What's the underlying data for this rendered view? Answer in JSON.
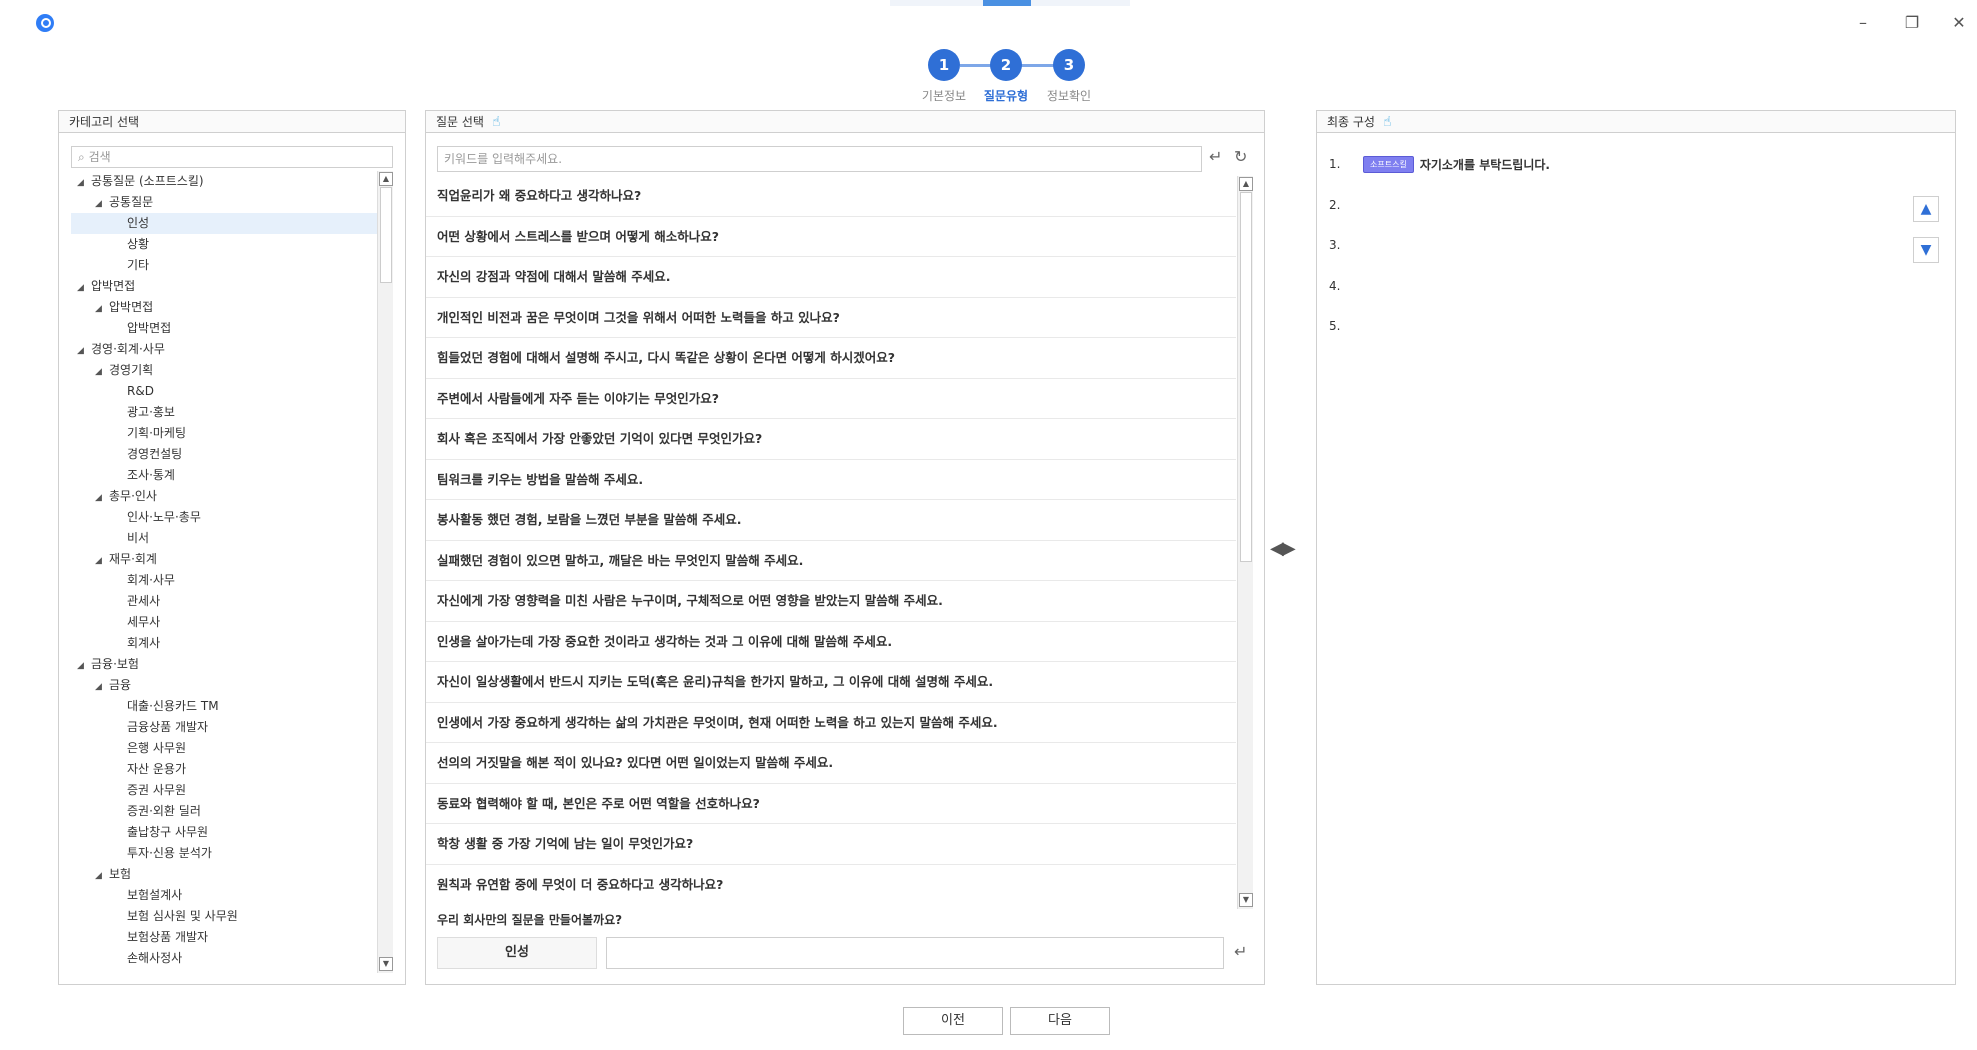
{
  "window": {
    "minimize": "–",
    "restore": "❐",
    "close": "✕"
  },
  "steps": [
    {
      "num": "1",
      "label": "기본정보"
    },
    {
      "num": "2",
      "label": "질문유형"
    },
    {
      "num": "3",
      "label": "정보확인"
    }
  ],
  "category_panel": {
    "title": "카테고리 선택",
    "search_placeholder": "검색",
    "tree": [
      {
        "label": "공통질문 (소프트스킬)",
        "level": 0,
        "expander": "◢"
      },
      {
        "label": "공통질문",
        "level": 1,
        "expander": "◢"
      },
      {
        "label": "인성",
        "level": 2,
        "expander": "",
        "selected": true
      },
      {
        "label": "상황",
        "level": 2,
        "expander": ""
      },
      {
        "label": "기타",
        "level": 2,
        "expander": ""
      },
      {
        "label": "압박면접",
        "level": 0,
        "expander": "◢"
      },
      {
        "label": "압박면접",
        "level": 1,
        "expander": "◢"
      },
      {
        "label": "압박면접",
        "level": 2,
        "expander": ""
      },
      {
        "label": "경영·회계·사무",
        "level": 0,
        "expander": "◢"
      },
      {
        "label": "경영기획",
        "level": 1,
        "expander": "◢"
      },
      {
        "label": "R&D",
        "level": 2,
        "expander": ""
      },
      {
        "label": "광고·홍보",
        "level": 2,
        "expander": ""
      },
      {
        "label": "기획·마케팅",
        "level": 2,
        "expander": ""
      },
      {
        "label": "경영컨설팅",
        "level": 2,
        "expander": ""
      },
      {
        "label": "조사·통계",
        "level": 2,
        "expander": ""
      },
      {
        "label": "총무·인사",
        "level": 1,
        "expander": "◢"
      },
      {
        "label": "인사·노무·총무",
        "level": 2,
        "expander": ""
      },
      {
        "label": "비서",
        "level": 2,
        "expander": ""
      },
      {
        "label": "재무·회계",
        "level": 1,
        "expander": "◢"
      },
      {
        "label": "회계·사무",
        "level": 2,
        "expander": ""
      },
      {
        "label": "관세사",
        "level": 2,
        "expander": ""
      },
      {
        "label": "세무사",
        "level": 2,
        "expander": ""
      },
      {
        "label": "회계사",
        "level": 2,
        "expander": ""
      },
      {
        "label": "금융·보험",
        "level": 0,
        "expander": "◢"
      },
      {
        "label": "금융",
        "level": 1,
        "expander": "◢"
      },
      {
        "label": "대출·신용카드 TM",
        "level": 2,
        "expander": ""
      },
      {
        "label": "금융상품 개발자",
        "level": 2,
        "expander": ""
      },
      {
        "label": "은행 사무원",
        "level": 2,
        "expander": ""
      },
      {
        "label": "자산 운용가",
        "level": 2,
        "expander": ""
      },
      {
        "label": "증권 사무원",
        "level": 2,
        "expander": ""
      },
      {
        "label": "증권·외환 딜러",
        "level": 2,
        "expander": ""
      },
      {
        "label": "출납창구 사무원",
        "level": 2,
        "expander": ""
      },
      {
        "label": "투자·신용 분석가",
        "level": 2,
        "expander": ""
      },
      {
        "label": "보험",
        "level": 1,
        "expander": "◢"
      },
      {
        "label": "보험설계사",
        "level": 2,
        "expander": ""
      },
      {
        "label": "보험 심사원 및 사무원",
        "level": 2,
        "expander": ""
      },
      {
        "label": "보험상품 개발자",
        "level": 2,
        "expander": ""
      },
      {
        "label": "손해사정사",
        "level": 2,
        "expander": ""
      }
    ]
  },
  "question_panel": {
    "title": "질문 선택",
    "search_placeholder": "키워드를 입력해주세요.",
    "questions": [
      "직업윤리가 왜 중요하다고 생각하나요?",
      "어떤 상황에서 스트레스를 받으며 어떻게 해소하나요?",
      "자신의 강점과 약점에 대해서 말씀해 주세요.",
      "개인적인 비전과 꿈은 무엇이며 그것을 위해서 어떠한 노력들을 하고 있나요?",
      "힘들었던 경험에 대해서 설명해 주시고, 다시 똑같은 상황이 온다면 어떻게 하시겠어요?",
      "주변에서 사람들에게 자주 듣는 이야기는 무엇인가요?",
      "회사 혹은 조직에서 가장 안좋았던 기억이 있다면 무엇인가요?",
      "팀워크를 키우는 방법을 말씀해 주세요.",
      "봉사활동 했던 경험, 보람을 느꼈던 부분을 말씀해 주세요.",
      "실패했던 경험이 있으면 말하고, 깨달은 바는 무엇인지 말씀해 주세요.",
      "자신에게 가장 영향력을 미친 사람은 누구이며, 구체적으로 어떤 영향을 받았는지 말씀해 주세요.",
      "인생을 살아가는데 가장 중요한 것이라고 생각하는 것과 그 이유에 대해 말씀해 주세요.",
      "자신이 일상생활에서 반드시 지키는 도덕(혹은 윤리)규칙을 한가지 말하고, 그 이유에 대해 설명해 주세요.",
      "인생에서 가장 중요하게 생각하는 삶의 가치관은 무엇이며, 현재 어떠한 노력을 하고 있는지 말씀해 주세요.",
      "선의의 거짓말을 해본 적이 있나요? 있다면 어떤 일이었는지 말씀해 주세요.",
      "동료와 협력해야 할 때, 본인은 주로 어떤 역할을 선호하나요?",
      "학창 생활 중 가장 기억에 남는 일이 무엇인가요?",
      "원칙과 유연함 중에 무엇이 더 중요하다고 생각하나요?"
    ],
    "custom_prompt": "우리 회사만의 질문을 만들어볼까요?",
    "custom_category": "인성",
    "custom_input_value": ""
  },
  "final_panel": {
    "title": "최종 구성",
    "items": [
      {
        "num": "1.",
        "tag": "소프트스킬",
        "text": "자기소개를 부탁드립니다."
      },
      {
        "num": "2.",
        "tag": "",
        "text": ""
      },
      {
        "num": "3.",
        "tag": "",
        "text": ""
      },
      {
        "num": "4.",
        "tag": "",
        "text": ""
      },
      {
        "num": "5.",
        "tag": "",
        "text": ""
      }
    ]
  },
  "buttons": {
    "prev": "이전",
    "next": "다음"
  }
}
